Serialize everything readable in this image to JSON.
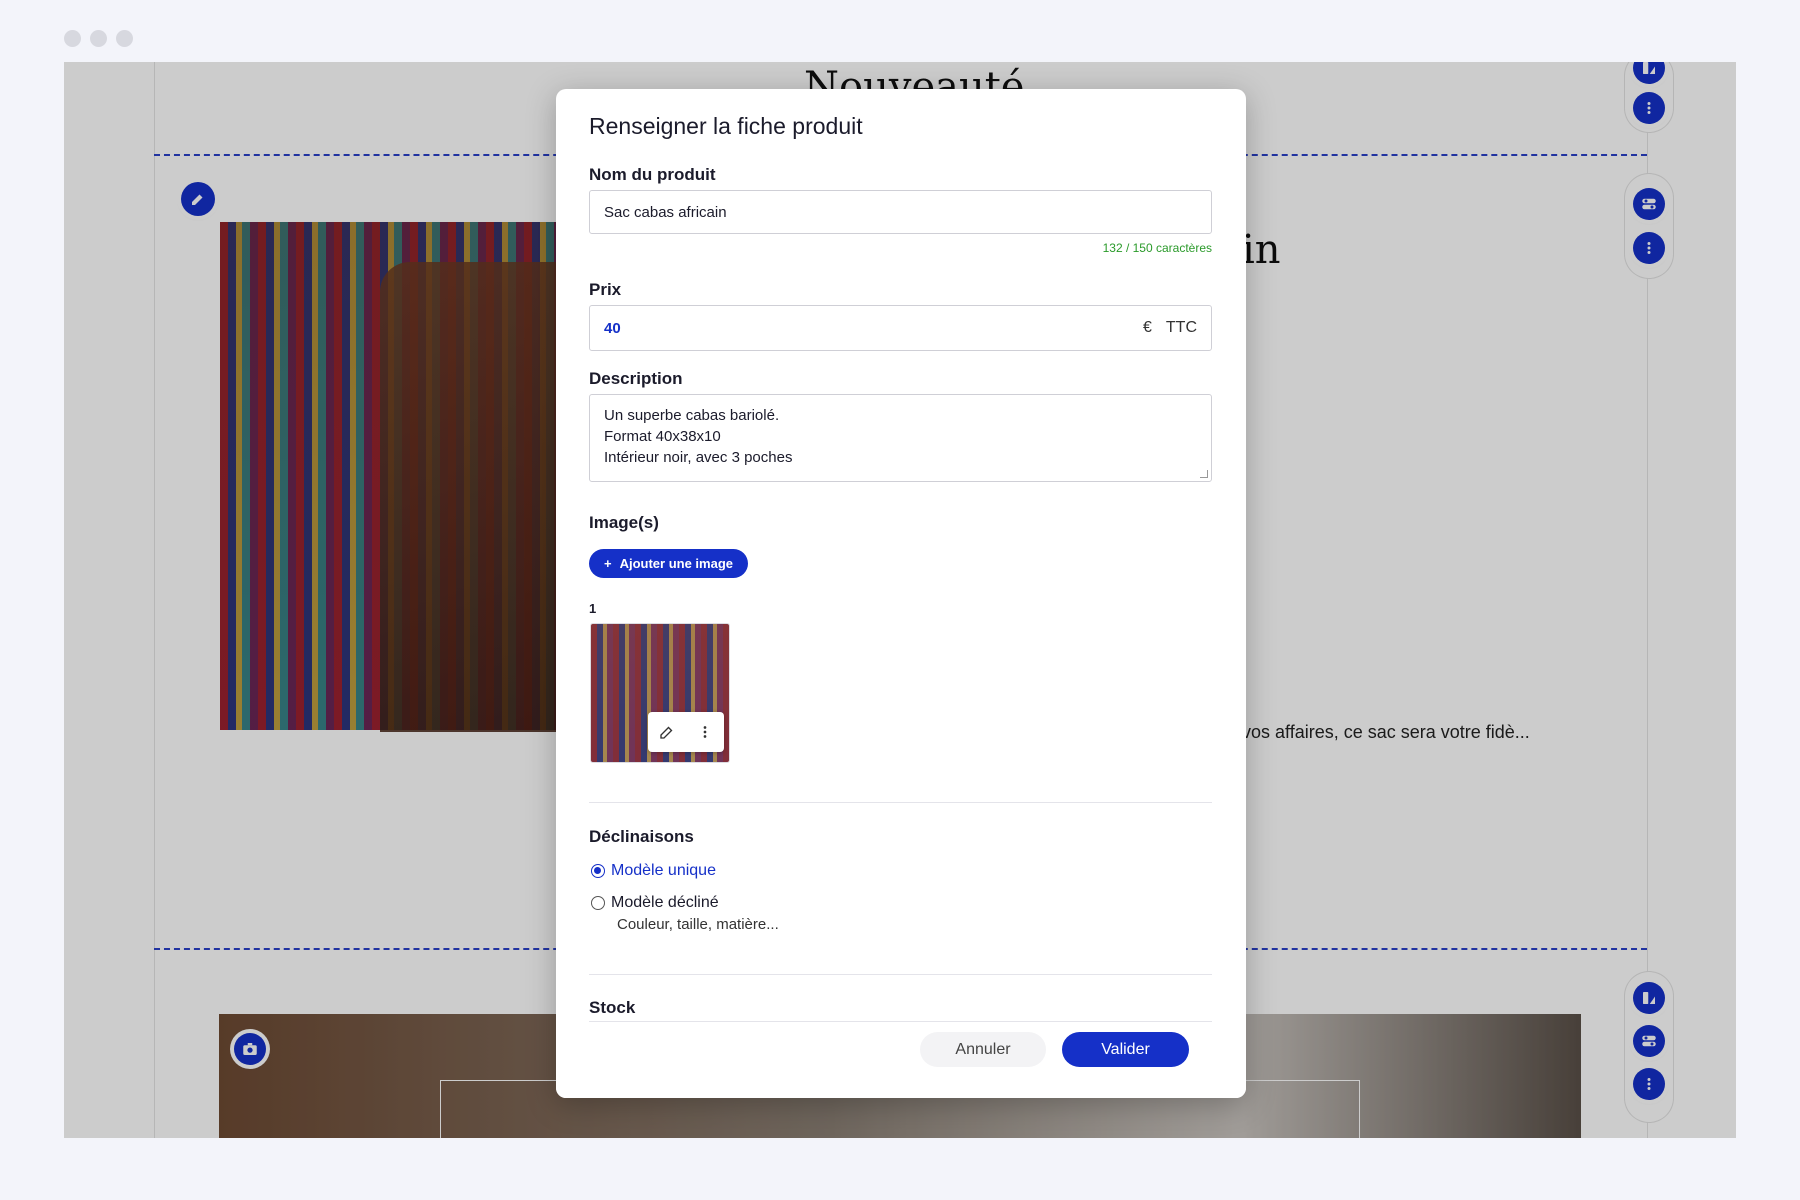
{
  "background": {
    "headline": "Nouveauté",
    "heading_fragment": "in",
    "text_snippet": "vos affaires, ce sac sera votre fidè..."
  },
  "modal": {
    "title": "Renseigner la fiche produit",
    "name": {
      "label": "Nom du produit",
      "value": "Sac cabas africain",
      "counter": "132 / 150 caractères"
    },
    "price": {
      "label": "Prix",
      "value": "40",
      "currency": "€",
      "tax": "TTC"
    },
    "description": {
      "label": "Description",
      "lines": [
        "Un superbe cabas bariolé.",
        "Format 40x38x10",
        "Intérieur noir, avec 3 poches"
      ]
    },
    "images": {
      "label": "Image(s)",
      "add_button": "Ajouter une image",
      "add_icon": "+",
      "index": "1"
    },
    "variants": {
      "label": "Déclinaisons",
      "options": [
        {
          "label": "Modèle unique",
          "selected": true
        },
        {
          "label": "Modèle décliné",
          "selected": false
        }
      ],
      "hint": "Couleur, taille, matière..."
    },
    "stock": {
      "label": "Stock"
    },
    "cancel_label": "Annuler",
    "confirm_label": "Valider"
  },
  "colors": {
    "accent": "#1530c8",
    "counter": "#2a9a2a"
  }
}
